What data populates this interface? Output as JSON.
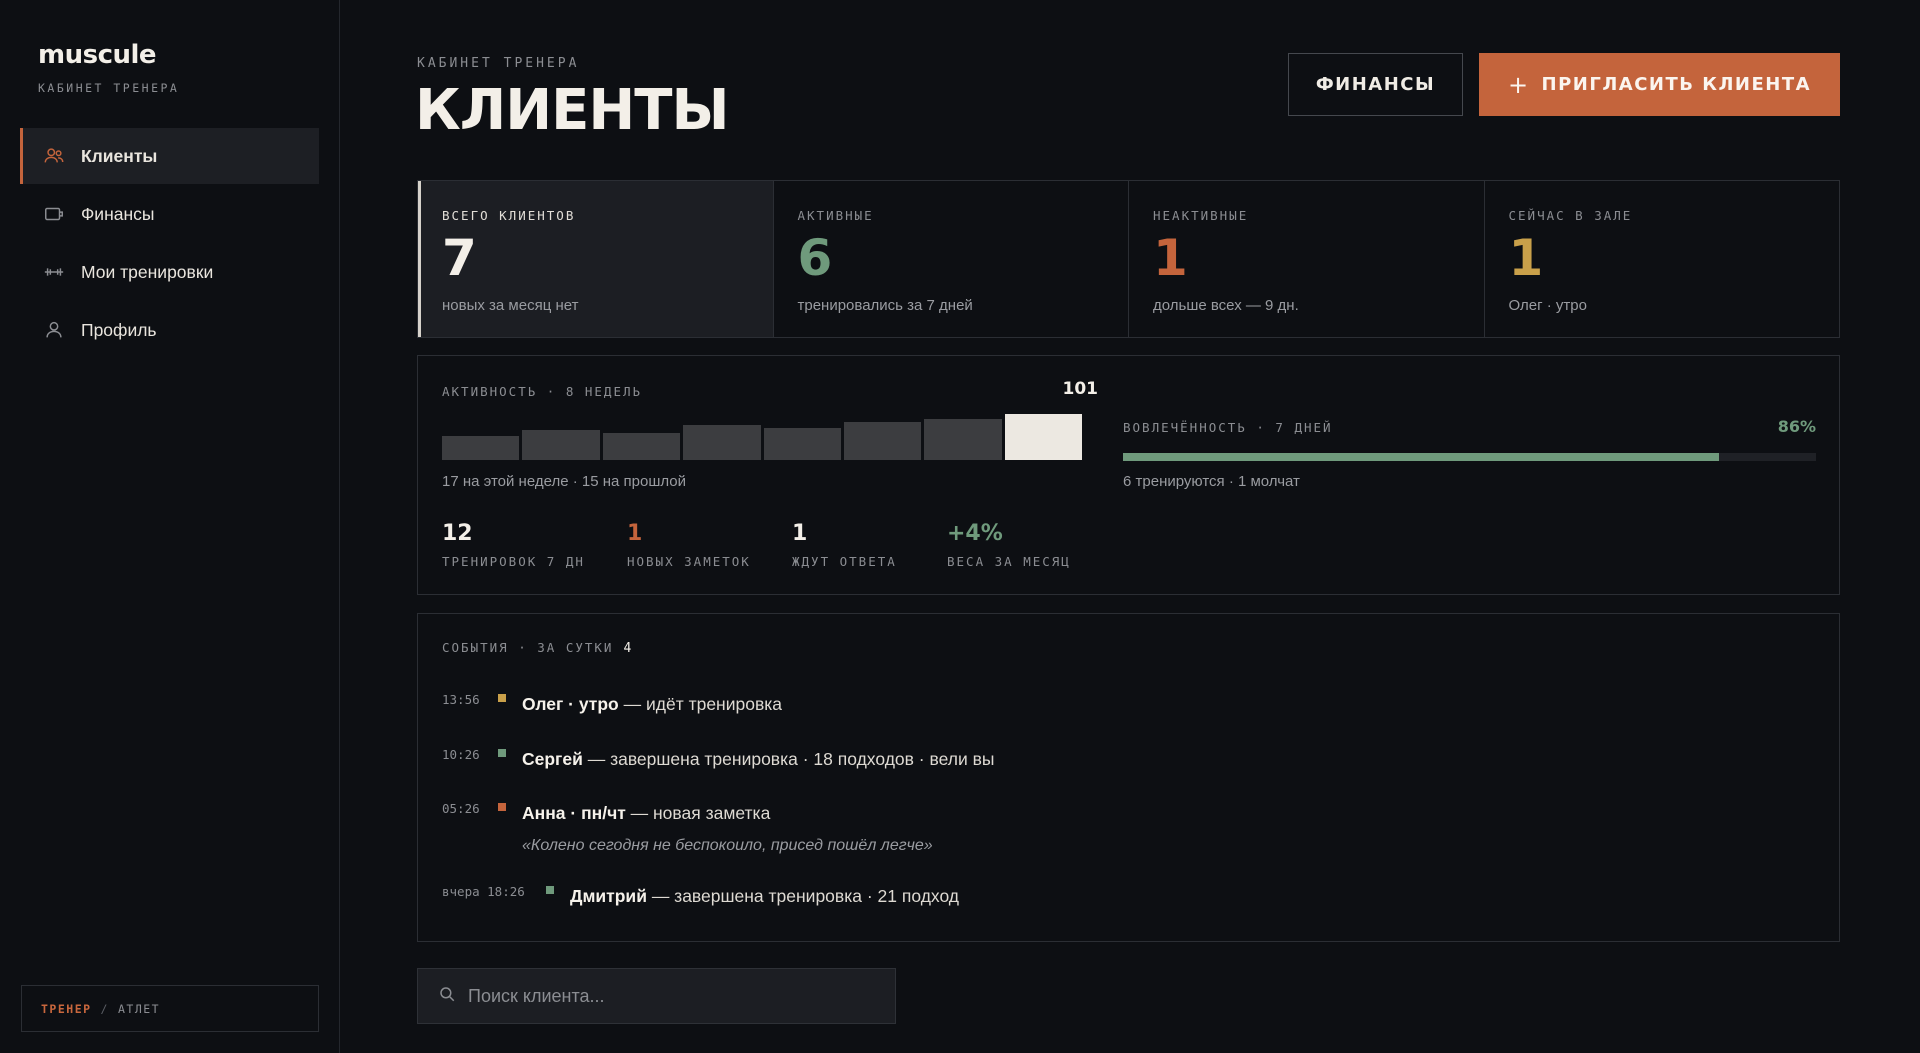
{
  "brand": {
    "logo": "muscule",
    "subtitle": "КАБИНЕТ ТРЕНЕРА"
  },
  "sidebar": {
    "items": [
      {
        "label": "Клиенты",
        "icon": "users-icon",
        "active": true
      },
      {
        "label": "Финансы",
        "icon": "wallet-icon",
        "active": false
      },
      {
        "label": "Мои тренировки",
        "icon": "dumbbell-icon",
        "active": false
      },
      {
        "label": "Профиль",
        "icon": "user-icon",
        "active": false
      }
    ],
    "role": {
      "active": "ТРЕНЕР",
      "separator": "/",
      "inactive": "АТЛЕТ"
    }
  },
  "header": {
    "eyebrow": "КАБИНЕТ ТРЕНЕРА",
    "title": "КЛИЕНТЫ",
    "finance_button": "ФИНАНСЫ",
    "invite_plus": "+",
    "invite_button": "ПРИГЛАСИТЬ КЛИЕНТА"
  },
  "stats": [
    {
      "label": "ВСЕГО КЛИЕНТОВ",
      "value": "7",
      "sub": "новых за месяц нет",
      "color": "#f3efe8"
    },
    {
      "label": "АКТИВНЫЕ",
      "value": "6",
      "sub": "тренировались за 7 дней",
      "color": "#6f9a7c"
    },
    {
      "label": "НЕАКТИВНЫЕ",
      "value": "1",
      "sub": "дольше всех — 9 дн.",
      "color": "#c4643c"
    },
    {
      "label": "СЕЙЧАС В ЗАЛЕ",
      "value": "1",
      "sub": "Олег · утро",
      "color": "#c9a04a"
    }
  ],
  "activity": {
    "label": "АКТИВНОСТЬ · 8 НЕДЕЛЬ",
    "total": "101",
    "weekly": [
      9,
      11,
      10,
      13,
      12,
      14,
      15,
      17
    ],
    "subtitle": "17 на этой неделе · 15 на прошлой",
    "kpis": [
      {
        "value": "12",
        "label": "ТРЕНИРОВОК 7 ДН",
        "color": "#f3efe8"
      },
      {
        "value": "1",
        "label": "НОВЫХ ЗАМЕТОК",
        "color": "#c4643c"
      },
      {
        "value": "1",
        "label": "ЖДУТ ОТВЕТА",
        "color": "#f3efe8"
      },
      {
        "value": "+4%",
        "label": "ВЕСА ЗА МЕСЯЦ",
        "color": "#6f9a7c"
      }
    ]
  },
  "engagement": {
    "label": "ВОВЛЕЧЁННОСТЬ · 7 ДНЕЙ",
    "percent_text": "86%",
    "percent": 86,
    "subtitle": "6 тренируются · 1 молчат"
  },
  "events": {
    "label": "СОБЫТИЯ · ЗА СУТКИ",
    "count": "4",
    "items": [
      {
        "time": "13:56",
        "color": "#c9a04a",
        "who": "Олег · утро",
        "text": " — идёт тренировка"
      },
      {
        "time": "10:26",
        "color": "#6f9a7c",
        "who": "Сергей",
        "text": " — завершена тренировка · 18 подходов · вели вы"
      },
      {
        "time": "05:26",
        "color": "#c4643c",
        "who": "Анна · пн/чт",
        "text": " — новая заметка",
        "quote": "«Колено сегодня не беспокоило, присед пошёл легче»"
      },
      {
        "time": "вчера 18:26",
        "color": "#6f9a7c",
        "who": "Дмитрий",
        "text": " — завершена тренировка · 21 подход"
      }
    ]
  },
  "search": {
    "placeholder": "Поиск клиента...",
    "icon": "search-icon"
  }
}
